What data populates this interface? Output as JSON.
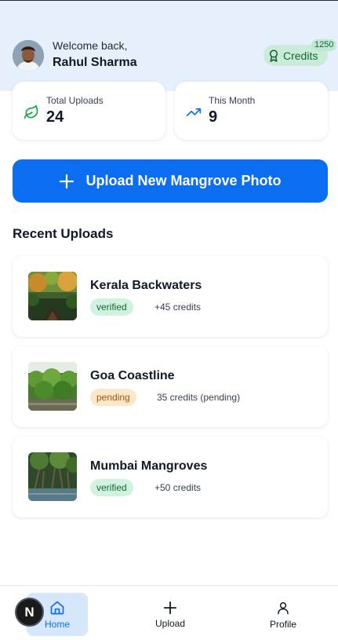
{
  "header": {
    "welcome": "Welcome back,",
    "user_name": "Rahul Sharma",
    "credits_label": "Credits",
    "credits_count": "1250",
    "avatar_icon": "user-avatar"
  },
  "stats": [
    {
      "label": "Total Uploads",
      "value": "24",
      "icon": "leaf-icon"
    },
    {
      "label": "This Month",
      "value": "9",
      "icon": "trending-up-icon"
    }
  ],
  "upload_button": {
    "label": "Upload New Mangrove Photo",
    "icon": "plus-icon"
  },
  "recent": {
    "title": "Recent Uploads",
    "items": [
      {
        "title": "Kerala Backwaters",
        "status": "verified",
        "credits": "+45 credits"
      },
      {
        "title": "Goa Coastline",
        "status": "pending",
        "credits": "35 credits (pending)"
      },
      {
        "title": "Mumbai Mangroves",
        "status": "verified",
        "credits": "+50 credits"
      }
    ]
  },
  "nav": {
    "items": [
      {
        "label": "Home",
        "icon": "home-icon",
        "active": true
      },
      {
        "label": "Upload",
        "icon": "plus-icon",
        "active": false
      },
      {
        "label": "Profile",
        "icon": "user-icon",
        "active": false
      }
    ]
  },
  "dev_badge": "N",
  "colors": {
    "primary": "#0b6ef0",
    "hero_bg": "#e6f0fd",
    "verified_bg": "#d1f2df",
    "pending_bg": "#fde7c8"
  }
}
